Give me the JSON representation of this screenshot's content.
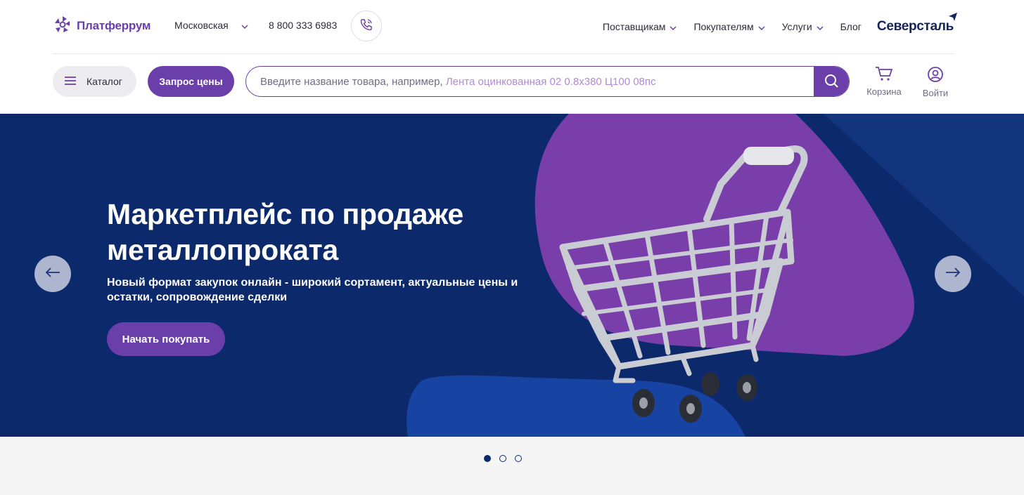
{
  "header": {
    "logo_text": "Платферрум",
    "region": "Московская",
    "phone": "8 800 333 6983",
    "nav": [
      {
        "label": "Поставщикам",
        "has_dropdown": true
      },
      {
        "label": "Покупателям",
        "has_dropdown": true
      },
      {
        "label": "Услуги",
        "has_dropdown": true
      },
      {
        "label": "Блог",
        "has_dropdown": false
      }
    ],
    "brand": "Северсталь"
  },
  "toolbar": {
    "catalog_label": "Каталог",
    "price_request_label": "Запрос цены",
    "search_placeholder": "Введите название товара, например,",
    "search_example": "Лента оцинкованная 02 0.8х380 Ц100 08пс",
    "cart_label": "Корзина",
    "login_label": "Войти"
  },
  "hero": {
    "title": "Маркетплейс по продаже металлопроката",
    "subtitle": "Новый формат закупок онлайн - широкий сортамент, актуальные цены и остатки, сопровождение сделки",
    "cta_label": "Начать покупать",
    "slides_count": 3,
    "active_slide": 1
  },
  "colors": {
    "accent": "#6b3fa9",
    "hero_bg": "#0c2a6b",
    "brand": "#14245c"
  },
  "icons": {
    "logo": "platferrum-logo-icon",
    "phone": "phone-icon",
    "menu": "hamburger-icon",
    "search": "search-icon",
    "cart": "cart-icon",
    "user": "user-icon",
    "prev": "arrow-left-icon",
    "next": "arrow-right-icon"
  }
}
